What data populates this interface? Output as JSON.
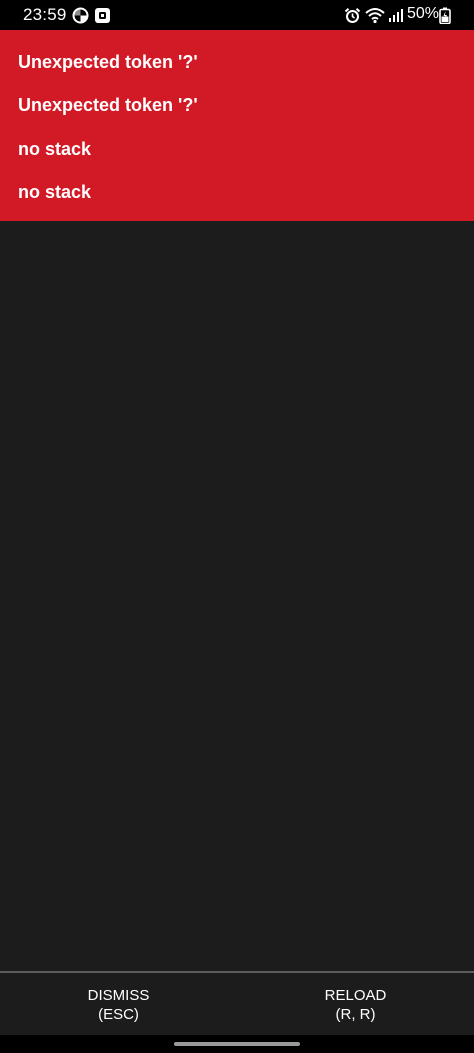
{
  "status_bar": {
    "time": "23:59",
    "battery": "50%",
    "left_icons": [
      "pinwheel-app-icon",
      "app-notification-icon"
    ],
    "right_icons": [
      "alarm-icon",
      "wifi-icon",
      "signal-icon",
      "battery-icon"
    ]
  },
  "error_box": {
    "background": "#d11a26",
    "messages": [
      "Unexpected token '?'",
      "Unexpected token '?'",
      "no stack",
      "no stack"
    ]
  },
  "footer": {
    "dismiss_label": "DISMISS",
    "dismiss_key": "(ESC)",
    "reload_label": "RELOAD",
    "reload_key": "(R, R)"
  }
}
